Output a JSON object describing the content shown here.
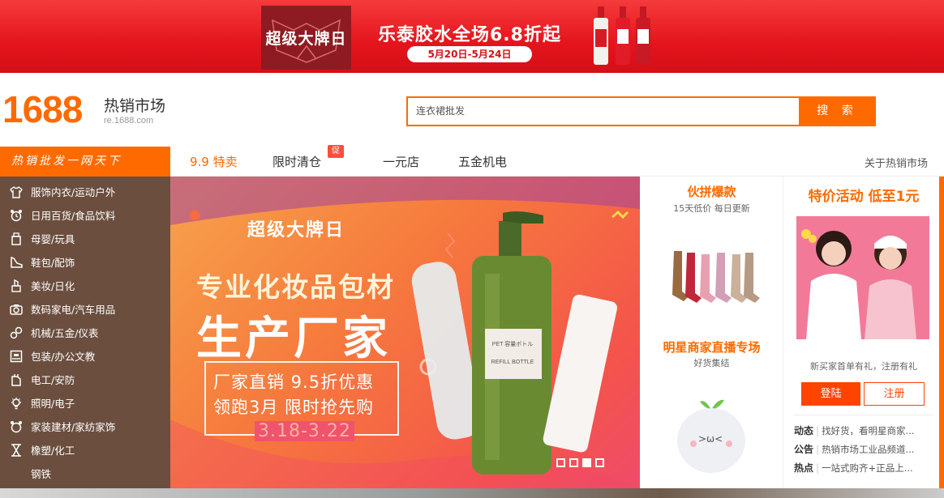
{
  "top_banner": {
    "badge": "超级大牌日",
    "title": "乐泰胶水全场6.8折起",
    "date": "5月20日-5月24日",
    "colors": {
      "background": "#e5141c",
      "badge": "#8e1b22"
    }
  },
  "header": {
    "logo_number": "1688",
    "site_name": "热销市场",
    "site_url": "re.1688.com",
    "search_placeholder": "连衣裙批发",
    "search_button": "搜 索",
    "colors": {
      "brand": "#ff6a00"
    }
  },
  "nav": {
    "category_title": "热销批发一网天下",
    "tabs": [
      {
        "label": "9.9 特卖",
        "active": true
      },
      {
        "label": "限时清仓",
        "active": false,
        "badge": "促"
      },
      {
        "label": "一元店",
        "active": false
      },
      {
        "label": "五金机电",
        "active": false
      }
    ],
    "about": "关于热销市场"
  },
  "categories": [
    {
      "label": "服饰内衣/运动户外",
      "icon": "shirt-icon"
    },
    {
      "label": "日用百货/食品饮料",
      "icon": "alarm-clock-icon"
    },
    {
      "label": "母婴/玩具",
      "icon": "baby-bottle-icon"
    },
    {
      "label": "鞋包/配饰",
      "icon": "shoe-icon"
    },
    {
      "label": "美妆/日化",
      "icon": "lipstick-icon"
    },
    {
      "label": "数码家电/汽车用品",
      "icon": "camera-icon"
    },
    {
      "label": "机械/五金/仪表",
      "icon": "gear-icon"
    },
    {
      "label": "包装/办公文教",
      "icon": "box-icon"
    },
    {
      "label": "电工/安防",
      "icon": "plug-icon"
    },
    {
      "label": "照明/电子",
      "icon": "bulb-icon"
    },
    {
      "label": "家装建材/家纺家饰",
      "icon": "home-clock-icon"
    },
    {
      "label": "橡塑/化工",
      "icon": "flask-icon"
    },
    {
      "label": "钢铁",
      "icon": ""
    }
  ],
  "main_banner": {
    "badge": "超级大牌日",
    "headline": "专业化妆品包材",
    "headline2": "生产厂家",
    "line1": "厂家直销  9.5折优惠",
    "line2": "领跑3月  限时抢先购",
    "date": "3.18-3.22",
    "bottle_label_top": "PET 容量ボトル",
    "bottle_label_bottom": "REFILL BOTTLE",
    "slide_count": 4,
    "active_slide": 3
  },
  "middle": {
    "section1_title": "伙拼爆款",
    "section1_sub": "15天低价 每日更新",
    "section2_title": "明星商家直播专场",
    "section2_sub": "好货集结"
  },
  "right": {
    "title": "特价活动 低至1元",
    "tip": "新买家首单有礼，注册有礼",
    "login": "登陆",
    "register": "注册",
    "news": [
      {
        "tag": "动态",
        "text": "找好货，看明星商家..."
      },
      {
        "tag": "公告",
        "text": "热销市场工业品频道..."
      },
      {
        "tag": "热点",
        "text": "一站式购齐+正品上..."
      }
    ]
  }
}
